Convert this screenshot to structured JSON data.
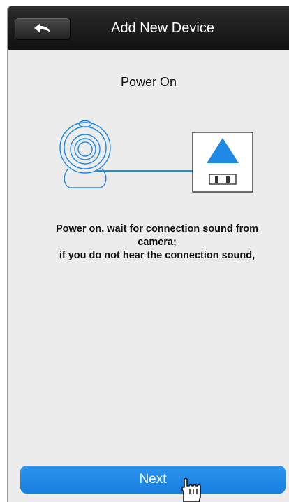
{
  "nav": {
    "title": "Add New Device",
    "back_icon": "back-arrow-icon"
  },
  "main": {
    "step_title": "Power On",
    "instructions": [
      "Power on, wait for connection sound from",
      "camera;",
      "if you do not hear the connection sound,"
    ]
  },
  "illustration": {
    "icons": [
      "webcam-icon",
      "power-outlet-icon"
    ],
    "accent_color": "#1e88e5"
  },
  "footer": {
    "next_label": "Next",
    "pointer_icon": "hand-pointer-icon"
  },
  "colors": {
    "nav_bar": "#1a1a1a",
    "background": "#ececec",
    "button": "#1a7ee0"
  }
}
